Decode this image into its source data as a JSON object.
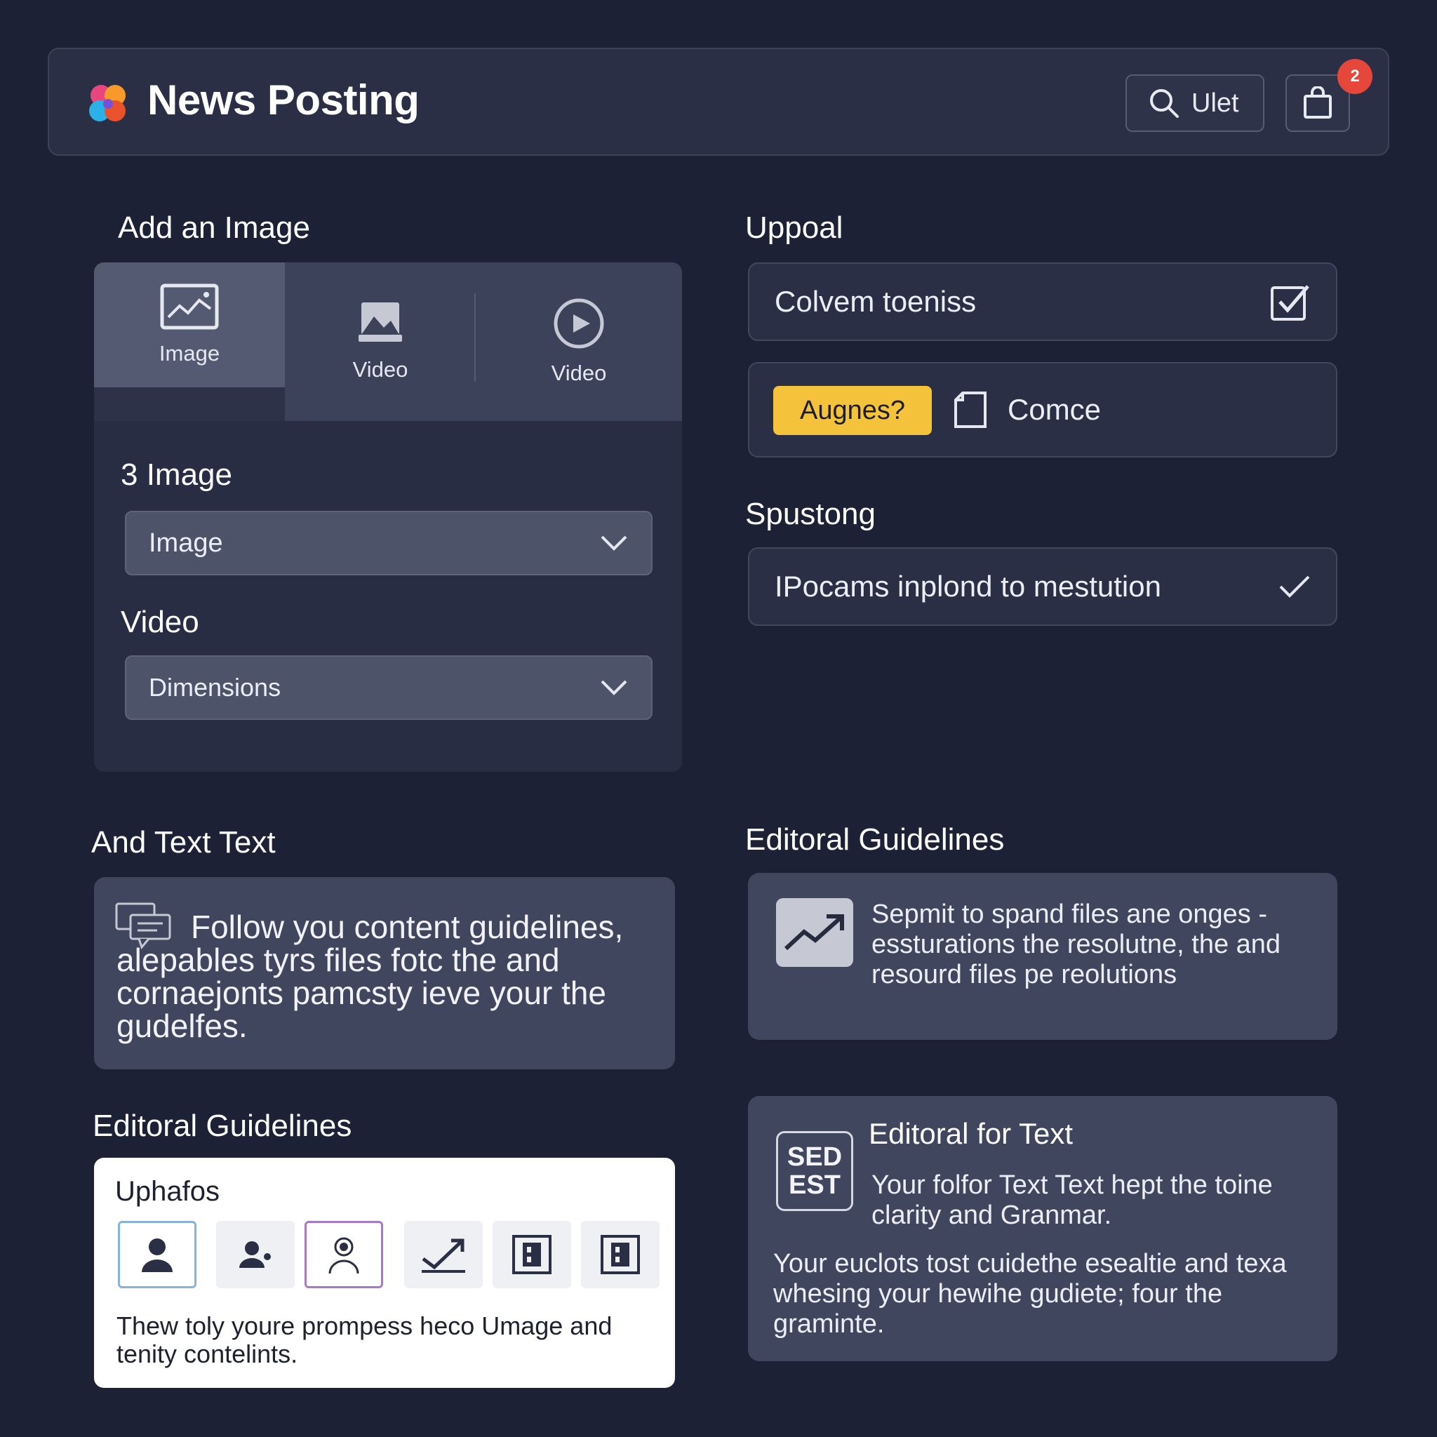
{
  "header": {
    "title": "News Posting",
    "search_label": "Ulet",
    "badge_count": "2"
  },
  "media": {
    "section_title": "Add an Image",
    "tabs": [
      {
        "label": "Image",
        "icon": "image-icon"
      },
      {
        "label": "Video",
        "icon": "landscape-icon"
      },
      {
        "label": "Video",
        "icon": "play-circle-icon"
      }
    ],
    "image_count_label": "3 Image",
    "image_select_value": "Image",
    "video_label": "Video",
    "video_select_value": "Dimensions"
  },
  "upload": {
    "section_title": "Uppoal",
    "input_value": "Colvem toeniss",
    "yellow_button": "Augnes?",
    "file_label": "Comce"
  },
  "spusting": {
    "section_title": "Spustong",
    "select_value": "IPocams inplond to mestution"
  },
  "text_section": {
    "title": "And Text Text",
    "body": "Follow you content guidelines, alepables tyrs files fotc the and cornaejonts pamcsty ieve your the gudelfes."
  },
  "editorial_right": {
    "title": "Editoral Guidelines",
    "body": "Sepmit to spand files ane onges - essturations the resolutne, the and resourd files pe reolutions"
  },
  "editorial_left": {
    "title": "Editoral Guidelines",
    "card_title": "Uphafos",
    "icons": [
      "user-icon",
      "user-edit-icon",
      "user-circle-icon",
      "trend-check-icon",
      "film-icon",
      "film-icon"
    ],
    "body": "Thew toly youre prompess heco Umage and tenity contelints."
  },
  "editorial_text": {
    "badge_line1": "SED",
    "badge_line2": "EST",
    "title": "Editoral for Text",
    "subtitle": "Your folfor Text Text hept the toine clarity and Granmar.",
    "body": "Your euclots tost cuidethe esealtie and texa whesing your hewihe gudiete; four the graminte."
  },
  "colors": {
    "background": "#1c2136",
    "panel": "#2a2f45",
    "accent_yellow": "#f5c33b",
    "badge_red": "#e5473a"
  }
}
